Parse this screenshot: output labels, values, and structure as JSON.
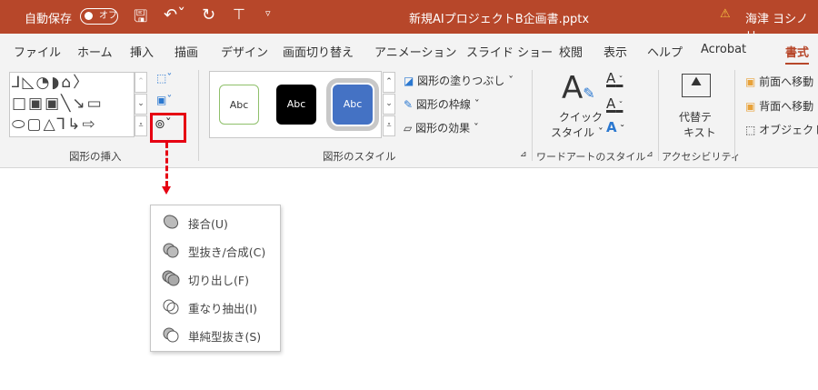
{
  "titlebar": {
    "autosave_label": "自動保存",
    "autosave_state": "オフ",
    "filename": "新規AIプロジェクトB企画書.pptx",
    "user": "海津 ヨシノリ"
  },
  "tabs": [
    "ファイル",
    "ホーム",
    "挿入",
    "描画",
    "デザイン",
    "画面切り替え",
    "アニメーション",
    "スライド ショー",
    "校閲",
    "表示",
    "ヘルプ",
    "Acrobat",
    "書式"
  ],
  "active_tab": "書式",
  "ribbon": {
    "insert_shapes": {
      "label": "図形の挿入"
    },
    "shape_styles": {
      "label": "図形のスタイル",
      "samples": [
        "Abc",
        "Abc",
        "Abc"
      ],
      "fill": "図形の塗りつぶし",
      "outline": "図形の枠線",
      "effects": "図形の効果"
    },
    "wordart": {
      "label": "ワードアートのスタイル",
      "quick_style": "クイック",
      "quick_style2": "スタイル"
    },
    "accessibility": {
      "label": "アクセシビリティ",
      "alt_text1": "代替テ",
      "alt_text2": "キスト"
    },
    "arrange": {
      "bring_forward": "前面へ移動",
      "send_backward": "背面へ移動",
      "selection_pane": "オブジェクト"
    }
  },
  "merge_menu": {
    "items": [
      {
        "label": "接合(U)",
        "icon": "union-icon"
      },
      {
        "label": "型抜き/合成(C)",
        "icon": "combine-icon"
      },
      {
        "label": "切り出し(F)",
        "icon": "fragment-icon"
      },
      {
        "label": "重なり抽出(I)",
        "icon": "intersect-icon"
      },
      {
        "label": "単純型抜き(S)",
        "icon": "subtract-icon"
      }
    ]
  },
  "colors": {
    "title_bg": "#b7472a",
    "highlight": "#e60012"
  }
}
